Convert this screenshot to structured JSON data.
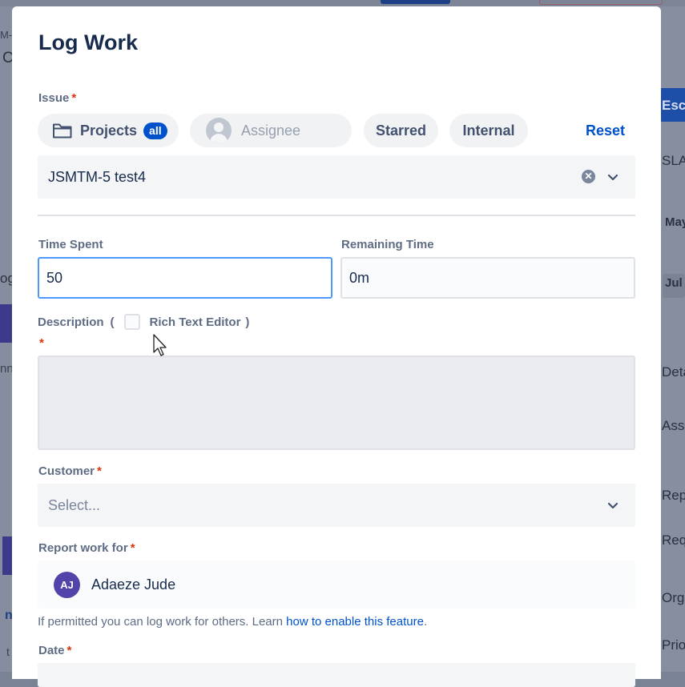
{
  "background": {
    "right_labels": [
      "Esca",
      "SLAs",
      "May",
      "Jul",
      "Deta",
      "Assi",
      "Repo",
      "Requ",
      "Orga",
      "Prio"
    ],
    "left_labels": [
      "M-",
      "C",
      "og",
      "nn",
      "n",
      "t"
    ]
  },
  "modal": {
    "title": "Log Work",
    "issue": {
      "label": "Issue",
      "filters": {
        "projects_label": "Projects",
        "projects_badge": "all",
        "assignee_placeholder": "Assignee",
        "starred_label": "Starred",
        "internal_label": "Internal",
        "reset_label": "Reset"
      },
      "selected": "JSMTM-5 test4"
    },
    "time_spent": {
      "label": "Time Spent",
      "value": "50"
    },
    "remaining_time": {
      "label": "Remaining Time",
      "value": "0m"
    },
    "description": {
      "label": "Description",
      "open_paren": "(",
      "rich_text_label": "Rich Text Editor",
      "close_paren": ")",
      "value": ""
    },
    "customer": {
      "label": "Customer",
      "placeholder": "Select..."
    },
    "report_work_for": {
      "label": "Report work for",
      "initials": "AJ",
      "user_name": "Adaeze Jude",
      "helper_text": "If permitted you can log work for others. Learn ",
      "helper_link": "how to enable this feature",
      "helper_end": "."
    },
    "date": {
      "label": "Date"
    },
    "required_marker": "*",
    "colors": {
      "accent": "#0052cc",
      "focus_border": "#4c9aff",
      "required": "#de350b",
      "avatar": "#5243aa"
    }
  }
}
